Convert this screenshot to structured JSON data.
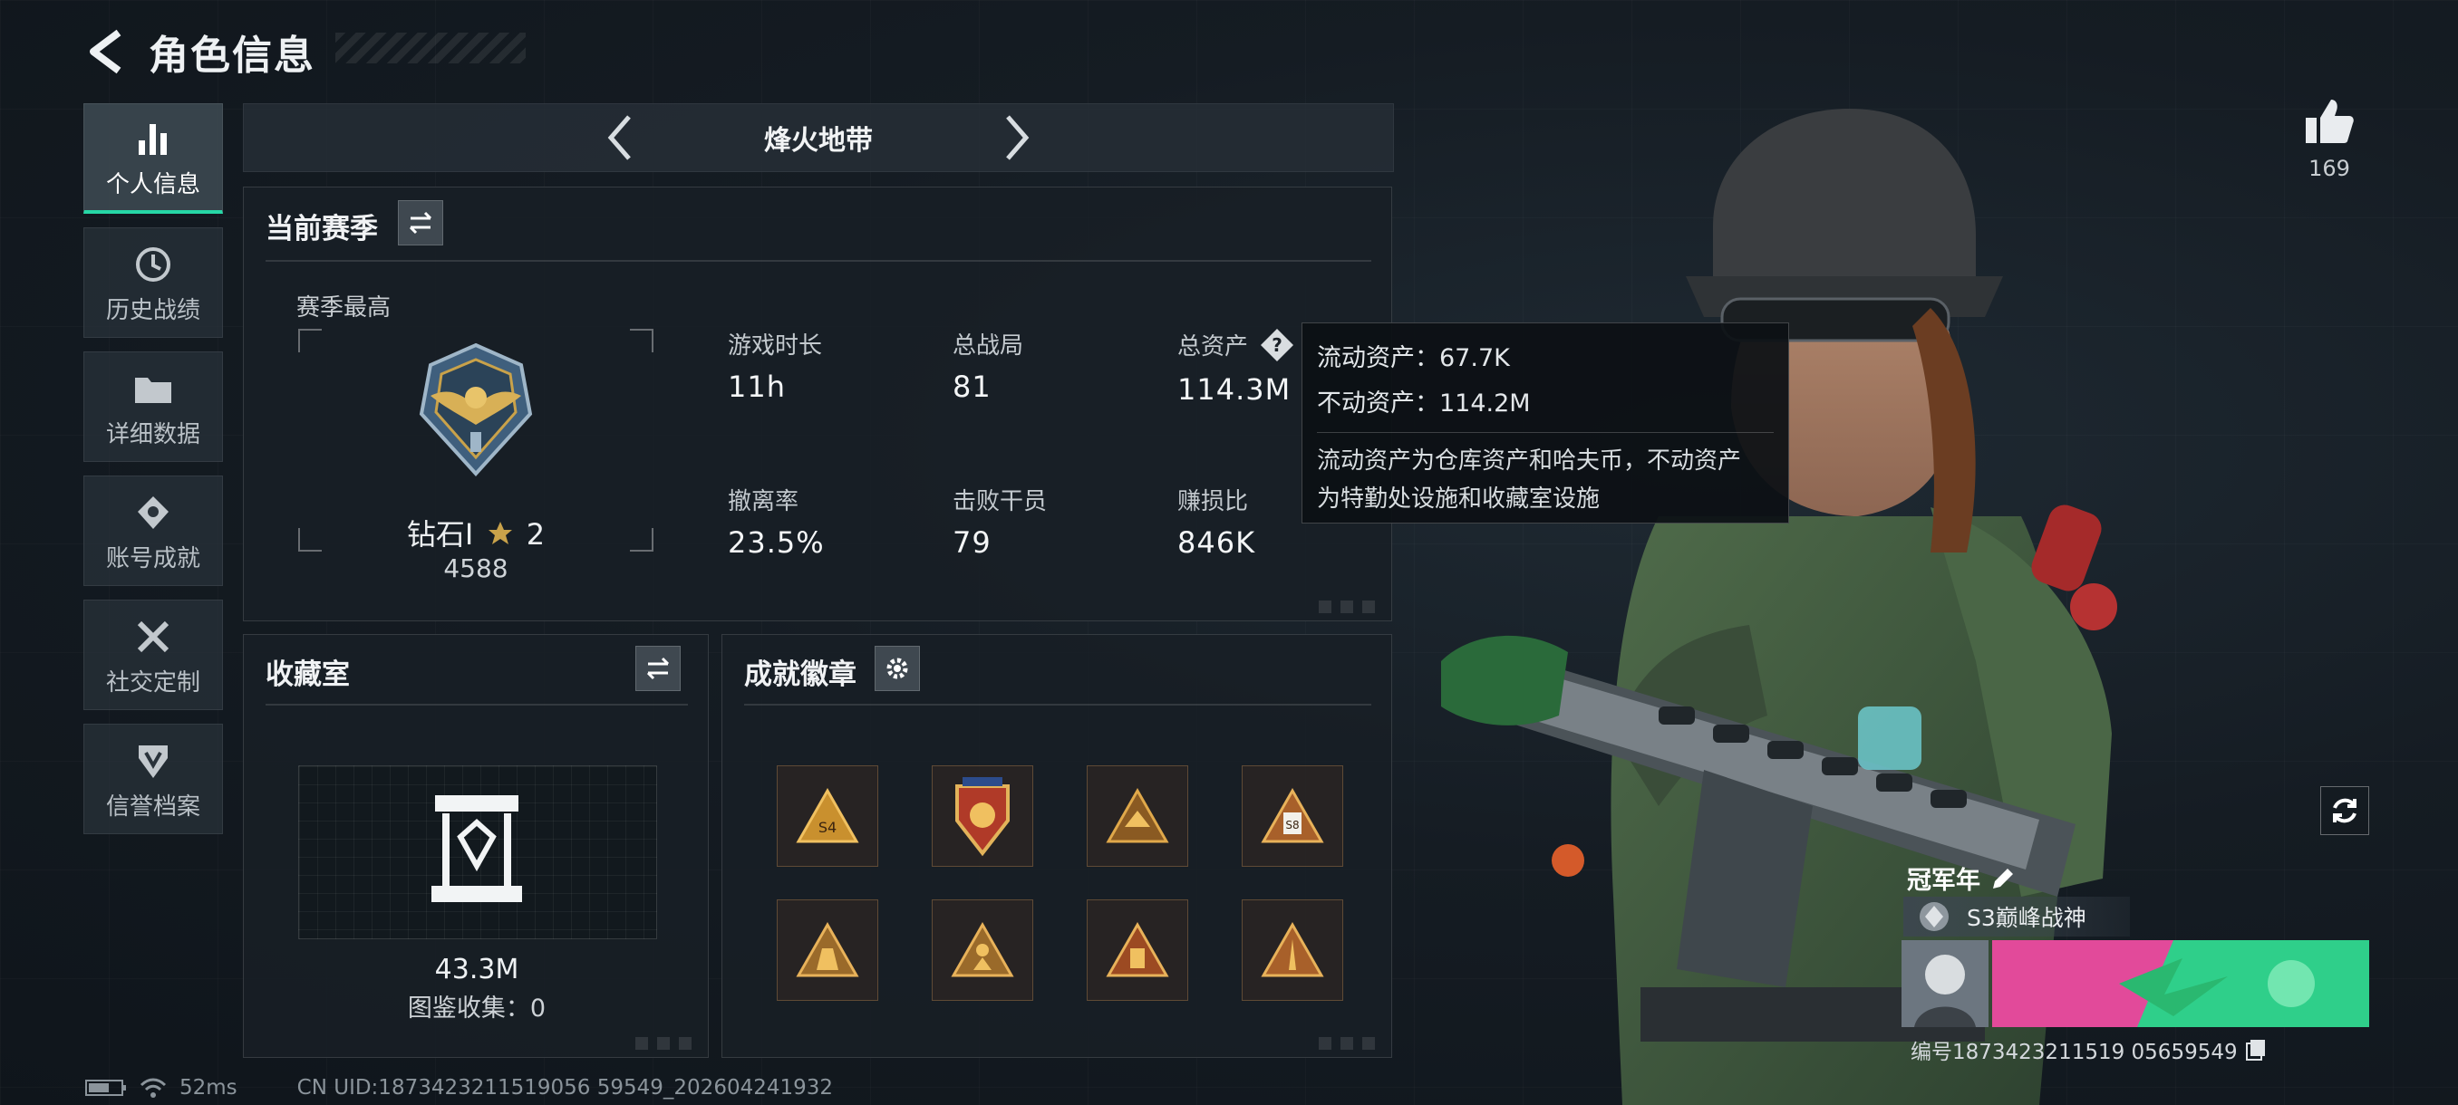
{
  "header": {
    "title": "角色信息"
  },
  "sidebar": {
    "items": [
      {
        "label": "个人信息",
        "icon": "bar-chart-icon"
      },
      {
        "label": "历史战绩",
        "icon": "history-icon"
      },
      {
        "label": "详细数据",
        "icon": "folder-icon"
      },
      {
        "label": "账号成就",
        "icon": "achievement-icon"
      },
      {
        "label": "社交定制",
        "icon": "tools-icon"
      },
      {
        "label": "信誉档案",
        "icon": "shield-icon"
      }
    ]
  },
  "mode": {
    "title": "烽火地带"
  },
  "season": {
    "title": "当前赛季",
    "best_label": "赛季最高",
    "rank_name": "钻石Ⅰ",
    "rank_stars": "2",
    "rank_score": "4588",
    "stats": [
      {
        "label": "游戏时长",
        "value": "11h"
      },
      {
        "label": "总战局",
        "value": "81"
      },
      {
        "label": "总资产",
        "value": "114.3M"
      },
      {
        "label": "撤离率",
        "value": "23.5%"
      },
      {
        "label": "击败干员",
        "value": "79"
      },
      {
        "label": "赚损比",
        "value": "846K"
      }
    ]
  },
  "tooltip": {
    "liquid": "流动资产：67.7K",
    "fixed": "不动资产：114.2M",
    "desc_line1": "流动资产为仓库资产和哈夫币，不动资产",
    "desc_line2": "为特勤处设施和收藏室设施"
  },
  "collection": {
    "title": "收藏室",
    "value": "43.3M",
    "count": "图鉴收集：0"
  },
  "badges": {
    "title": "成就徽章"
  },
  "likes": {
    "count": "169"
  },
  "card": {
    "title": "冠军年",
    "subtitle": "S3巅峰战神",
    "id_text": "编号1873423211519 05659549"
  },
  "status": {
    "ping": "52ms",
    "uid": "CN UID:1873423211519056 59549_202604241932"
  },
  "colors": {
    "accent": "#26d7a6",
    "gold": "#c9a24a",
    "panel": "#181f26"
  }
}
